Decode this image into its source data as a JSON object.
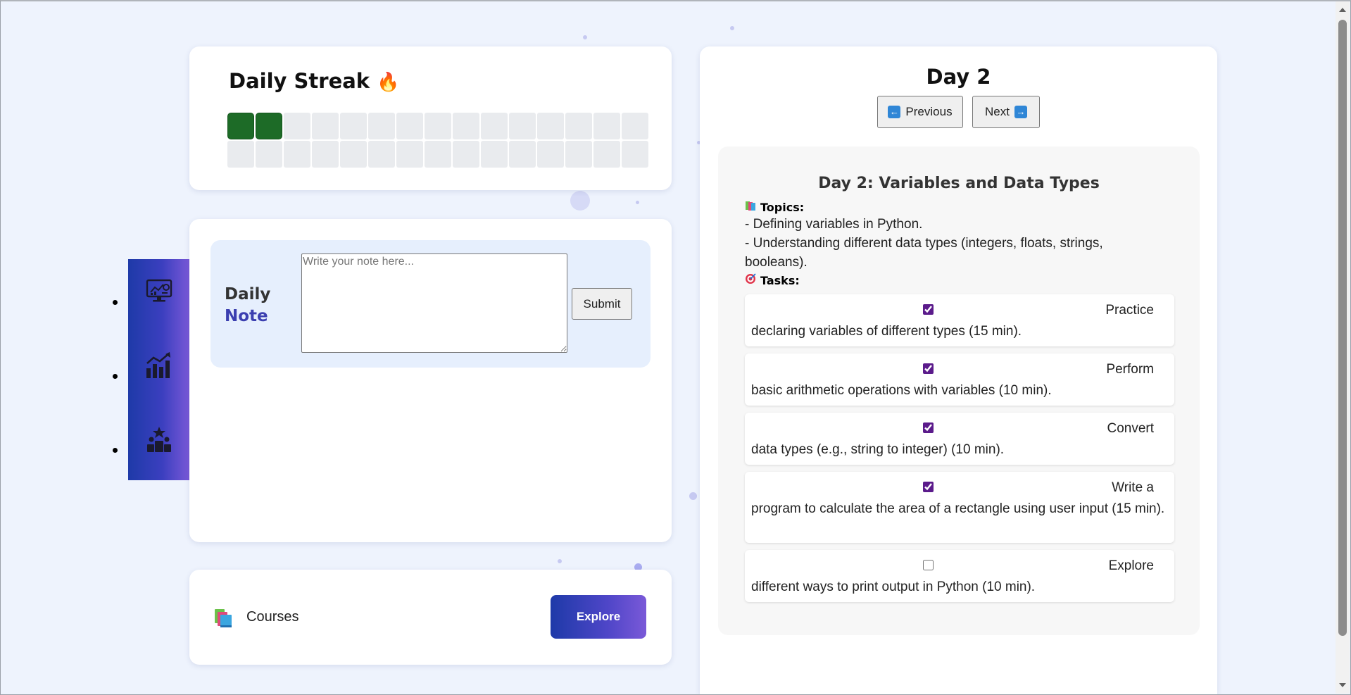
{
  "streak": {
    "title": "Daily Streak",
    "icon": "fire-icon",
    "completed_days": 2,
    "total_days": 30,
    "colors": {
      "completed": "#1d6b27",
      "empty": "#e9ebee"
    }
  },
  "sidebar": {
    "items": [
      {
        "icon": "monitor-dashboard-icon"
      },
      {
        "icon": "bar-chart-growth-icon"
      },
      {
        "icon": "leaderboard-podium-icon"
      }
    ]
  },
  "note": {
    "title_line1": "Daily",
    "title_line2": "Note",
    "placeholder": "Write your note here...",
    "value": "",
    "submit_label": "Submit"
  },
  "courses": {
    "icon": "books-icon",
    "label": "Courses",
    "explore_label": "Explore"
  },
  "day": {
    "heading": "Day 2",
    "prev_label": "Previous",
    "next_label": "Next",
    "lesson_title": "Day 2: Variables and Data Types",
    "topics_label": "Topics:",
    "topics": [
      "- Defining variables in Python.",
      "- Understanding different data types (integers, floats, strings, booleans)."
    ],
    "tasks_label": "Tasks:",
    "tasks": [
      {
        "first_word": "Practice",
        "rest": "declaring variables of different types (15 min).",
        "done": true
      },
      {
        "first_word": "Perform",
        "rest": "basic arithmetic operations with variables (10 min).",
        "done": true
      },
      {
        "first_word": "Convert",
        "rest": "data types (e.g., string to integer) (10 min).",
        "done": true
      },
      {
        "first_word": "Write a",
        "rest": "program to calculate the area of a rectangle using user input (15 min).",
        "done": true
      },
      {
        "first_word": "Explore",
        "rest": "different ways to print output in Python (10 min).",
        "done": false
      }
    ]
  },
  "colors": {
    "accent_start": "#1e3aa8",
    "accent_end": "#7a59d8",
    "background": "#eef3fd"
  }
}
